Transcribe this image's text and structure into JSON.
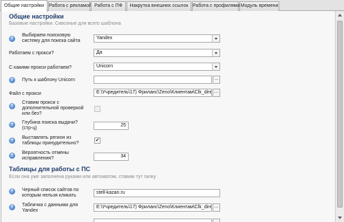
{
  "tabs": [
    {
      "label": "Общие настройки",
      "active": true
    },
    {
      "label": "Работа с рекламой"
    },
    {
      "label": "Работа с ПФ"
    },
    {
      "label": "Накрутка внешних ссылок"
    },
    {
      "label": "Работа с профилями"
    },
    {
      "label": "Модуль времени"
    }
  ],
  "general": {
    "title": "Общие настройки",
    "subtitle": "Базовые настройки. Сквозные для всего шаблона",
    "search_system": {
      "label": "Выбираем поисковую систему для поиска сайта",
      "value": "Yandex"
    },
    "proxy_enabled": {
      "label": "Работаем с прокси?",
      "value": "Да"
    },
    "proxy_type": {
      "label": "С какими прокси работаем?",
      "value": "Unicorn"
    },
    "unicorn_path": {
      "label": "Путь к шаблону Unicorn",
      "value": ""
    },
    "proxy_file": {
      "label": "Файл с прокси",
      "value": "E:\\Учредитель\\17) Фриланс\\Zeno\\Клиентам\\Clk_direc"
    },
    "proxy_check": {
      "label": "Ставим прокси с дополнительной проверкой или без?",
      "checked": false
    },
    "search_depth": {
      "label": "Глубина поиска выдачи? (стр-ц)",
      "value": "25"
    },
    "region_force": {
      "label": "Выставлять регион из таблицы принудительно?",
      "checked": true
    },
    "fix_probability": {
      "label": "Вероятность отмены исправления?",
      "value": "34"
    }
  },
  "ps_tables": {
    "title": "Таблицы для работы с ПС",
    "subtitle": "Если она уже заполнена руками или автоматом, ставим тут галку",
    "blacklist": {
      "label": "Черный список сайтов по которым нельзя кликать",
      "value": "stell-kazan.ru"
    },
    "yandex_table": {
      "label": "Табличка с данными для Yandex",
      "value": "E:\\Учредитель\\17) Фриланс\\Zeno\\Клиентам\\Clk_direc"
    }
  },
  "icons": {
    "help": "help-icon",
    "browse": "ellipsis-icon",
    "dropdown": "chevron-down-icon",
    "check": "checkmark-icon"
  },
  "colors": {
    "section_title": "#1f3d6b",
    "help_icon": "#2f6ec0",
    "tab_active": "#ffffff",
    "panel_bg": "#f7f7f7"
  }
}
